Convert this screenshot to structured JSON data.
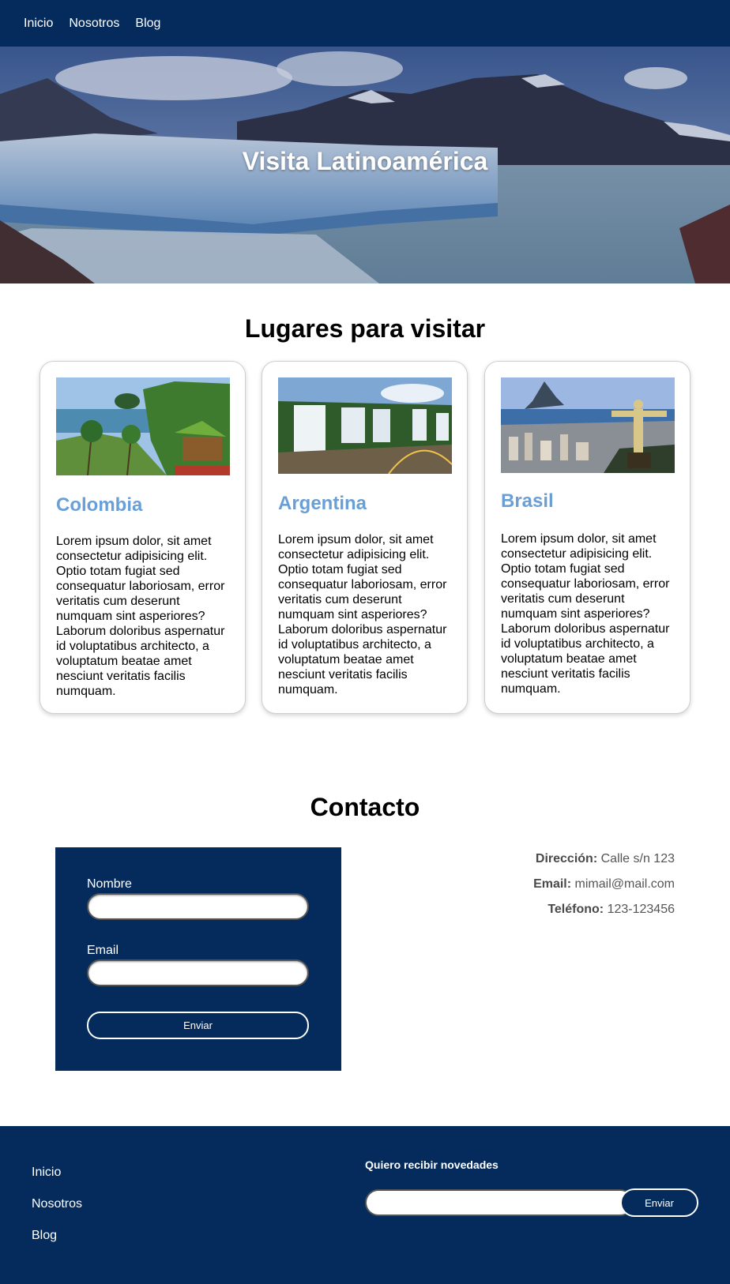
{
  "nav": {
    "items": [
      "Inicio",
      "Nosotros",
      "Blog"
    ]
  },
  "hero": {
    "title": "Visita Latinoamérica"
  },
  "places": {
    "title": "Lugares para visitar",
    "cards": [
      {
        "name": "Colombia",
        "text": "Lorem ipsum dolor, sit amet consectetur adipisicing elit. Optio totam fugiat sed consequatur laboriosam, error veritatis cum deserunt numquam sint asperiores? Laborum doloribus aspernatur id voluptatibus architecto, a voluptatum beatae amet nesciunt veritatis facilis numquam."
      },
      {
        "name": "Argentina",
        "text": "Lorem ipsum dolor, sit amet consectetur adipisicing elit. Optio totam fugiat sed consequatur laboriosam, error veritatis cum deserunt numquam sint asperiores? Laborum doloribus aspernatur id voluptatibus architecto, a voluptatum beatae amet nesciunt veritatis facilis numquam."
      },
      {
        "name": "Brasil",
        "text": "Lorem ipsum dolor, sit amet consectetur adipisicing elit. Optio totam fugiat sed consequatur laboriosam, error veritatis cum deserunt numquam sint asperiores? Laborum doloribus aspernatur id voluptatibus architecto, a voluptatum beatae amet nesciunt veritatis facilis numquam."
      }
    ]
  },
  "contact": {
    "title": "Contacto",
    "form": {
      "name_label": "Nombre",
      "name_value": "",
      "email_label": "Email",
      "email_value": "",
      "submit_label": "Enviar"
    },
    "info": [
      {
        "label": "Dirección:",
        "value": "Calle s/n 123"
      },
      {
        "label": "Email:",
        "value": "mimail@mail.com"
      },
      {
        "label": "Teléfono:",
        "value": "123-123456"
      }
    ]
  },
  "footer": {
    "links": [
      "Inicio",
      "Nosotros",
      "Blog"
    ],
    "newsletter": {
      "title": "Quiero recibir novedades",
      "input_value": "",
      "button_label": "Enviar"
    }
  },
  "colors": {
    "navy": "#042b5c",
    "accent_blue": "#6a9fd6"
  },
  "icons": [
    "hero-glacier-photo",
    "colombia-beach-photo",
    "argentina-waterfalls-photo",
    "brasil-christ-photo"
  ]
}
